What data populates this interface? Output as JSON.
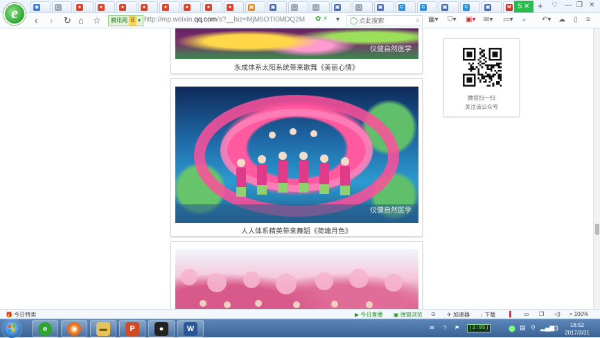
{
  "tabs": [
    {
      "icon": "◉",
      "color": "#3b7ad8"
    },
    {
      "icon": "▢",
      "color": "#9aa5b4"
    },
    {
      "icon": "●",
      "color": "#d8462c"
    },
    {
      "icon": "●",
      "color": "#d8462c"
    },
    {
      "icon": "●",
      "color": "#d8462c"
    },
    {
      "icon": "●",
      "color": "#d8462c"
    },
    {
      "icon": "●",
      "color": "#d8462c"
    },
    {
      "icon": "●",
      "color": "#d8462c"
    },
    {
      "icon": "●",
      "color": "#d8462c"
    },
    {
      "icon": "●",
      "color": "#d8462c"
    },
    {
      "icon": "▣",
      "color": "#e0892a"
    },
    {
      "icon": "▣",
      "color": "#4b6fb0"
    },
    {
      "icon": "▢",
      "color": "#9aa5b4"
    },
    {
      "icon": "▢",
      "color": "#9aa5b4"
    },
    {
      "icon": "▣",
      "color": "#4b6fb0"
    },
    {
      "icon": "▢",
      "color": "#9aa5b4"
    },
    {
      "icon": "▣",
      "color": "#4b6fb0"
    },
    {
      "icon": "C",
      "color": "#2d8fd8"
    },
    {
      "icon": "C",
      "color": "#2d8fd8"
    },
    {
      "icon": "▣",
      "color": "#4b6fb0"
    },
    {
      "icon": "C",
      "color": "#2d8fd8"
    },
    {
      "icon": "▣",
      "color": "#4b6fb0"
    },
    {
      "icon": "M",
      "color": "#c9302c"
    }
  ],
  "new_tab_label": "5",
  "address": {
    "site_label": "腾讯网",
    "ext_label": "证",
    "url_prefix": "http://mp.weixin.",
    "url_domain": "qq.com",
    "url_rest": "/s?__biz=MjM5OTI0MDQ2M",
    "search_placeholder": "点此搜索"
  },
  "content": {
    "card1_caption": "永成体系太阳系统带来歌舞《美丽心情》",
    "card2_caption": "人人体系精英带来舞蹈《荷塘月色》",
    "watermark": "仪健自然医学",
    "qr_line1": "微信扫一扫",
    "qr_line2": "关注该公众号"
  },
  "statusbar": {
    "left": "今日特卖",
    "live": "今日直播",
    "mode": "弹窗浏览",
    "accel": "加速器",
    "download": "下载",
    "zoom": "100%"
  },
  "taskbar": {
    "battery": "(3:05)",
    "time": "16:52",
    "date": "2017/3/31"
  }
}
